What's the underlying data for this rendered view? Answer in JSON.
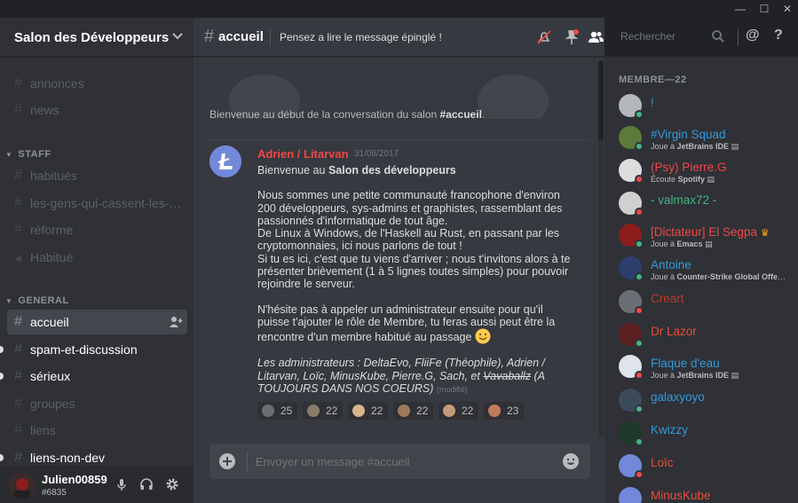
{
  "window": {
    "min_label": "—",
    "max_label": "☐",
    "close_label": "✕"
  },
  "guild": {
    "name": "Salon des Développeurs"
  },
  "channels": {
    "top": [
      {
        "label": "annonces"
      },
      {
        "label": "news"
      }
    ],
    "staff": {
      "title": "STAFF",
      "items": [
        {
          "label": "habitués"
        },
        {
          "label": "les-gens-qui-cassent-les-c..."
        },
        {
          "label": "réforme"
        },
        {
          "label": "Habitué"
        }
      ]
    },
    "general": {
      "title": "GENERAL",
      "items": [
        {
          "label": "accueil"
        },
        {
          "label": "spam-et-discussion"
        },
        {
          "label": "sérieux"
        },
        {
          "label": "groupes"
        },
        {
          "label": "liens"
        },
        {
          "label": "liens-non-dev"
        }
      ]
    }
  },
  "user": {
    "name": "Julien00859",
    "tag": "#6835"
  },
  "header": {
    "channel": "accueil",
    "topic": "Pensez a lire le message épinglé !",
    "search_placeholder": "Rechercher"
  },
  "welcome": {
    "prefix": "Bienvenue au début de la conversation du salon ",
    "channel": "#accueil",
    "suffix": "."
  },
  "message": {
    "author": "Adrien / Litarvan",
    "timestamp": "31/08/2017",
    "line1_prefix": "Bienvenue au ",
    "line1_bold": "Salon des développeurs",
    "para1": "Nous sommes une petite communauté francophone d'environ 200 développeurs, sys-admins et graphistes, rassemblant des passionnés d'informatique de tout âge.",
    "para2": "De Linux à Windows, de l'Haskell au Rust, en passant par les cryptomonnaies, ici nous parlons de tout !",
    "para3": "Si tu es ici, c'est que tu viens d'arriver ; nous t'invitons alors à te présenter brièvement (1 à 5 lignes toutes simples) pour pouvoir rejoindre le serveur.",
    "para4": "N'hésite pas à appeler un administrateur ensuite pour qu'il puisse t'ajouter le rôle de Membre, tu feras aussi peut être la rencontre d'un membre habitué au passage",
    "admins_prefix": "Les administrateurs : DeltaEvo, FliiFe (Théophile), Adrien / Litarvan, Loïc, MinusKube, Pierre.G, Sach, et ",
    "admins_struck": "Vavaballz",
    "admins_suffix": " (A TOUJOURS DANS NOS COEURS)",
    "edited": "(modifié)",
    "reactions": [
      {
        "count": "25"
      },
      {
        "count": "22"
      },
      {
        "count": "22"
      },
      {
        "count": "22"
      },
      {
        "count": "22"
      },
      {
        "count": "23"
      }
    ]
  },
  "composer": {
    "placeholder": "Envoyer un message #accueil"
  },
  "members": {
    "title": "MEMBRE—22",
    "list": [
      {
        "name": "!",
        "color": "#3498db",
        "activity": ""
      },
      {
        "name": "#Virgin Squad",
        "color": "#3498db",
        "activity_prefix": "Joue à ",
        "activity": "JetBrains IDE"
      },
      {
        "name": "(Psy) Pierre.G",
        "color": "#f04747",
        "activity_prefix": "Écoute ",
        "activity": "Spotify"
      },
      {
        "name": "- valmax72 -",
        "color": "#43b581",
        "activity": ""
      },
      {
        "name": "[Dictateur] El Segpa",
        "color": "#f04747",
        "activity_prefix": "Joue à ",
        "activity": "Emacs"
      },
      {
        "name": "Antoine",
        "color": "#3498db",
        "activity_prefix": "Joue à ",
        "activity": "Counter-Strike Global Offen..."
      },
      {
        "name": "Creart",
        "color": "#e74c3c",
        "activity": ""
      },
      {
        "name": "Dr Lazor",
        "color": "#e74c3c",
        "activity": ""
      },
      {
        "name": "Flaque d'eau",
        "color": "#3498db",
        "activity_prefix": "Joue à ",
        "activity": "JetBrains IDE"
      },
      {
        "name": "galaxyoyo",
        "color": "#3498db",
        "activity": ""
      },
      {
        "name": "Kwizzy",
        "color": "#3498db",
        "activity": ""
      },
      {
        "name": "Loïc",
        "color": "#e74c3c",
        "activity": ""
      },
      {
        "name": "MinusKube",
        "color": "#e74c3c",
        "activity": ""
      }
    ]
  }
}
